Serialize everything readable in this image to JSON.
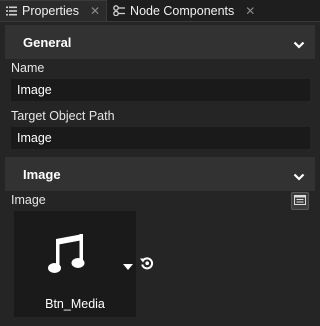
{
  "tabs": [
    {
      "label": "Properties",
      "active": true
    },
    {
      "label": "Node Components",
      "active": false
    }
  ],
  "sections": {
    "general": {
      "title": "General"
    },
    "image": {
      "title": "Image"
    }
  },
  "fields": {
    "name_label": "Name",
    "name_value": "Image",
    "target_label": "Target Object Path",
    "target_value": "Image",
    "image_label": "Image",
    "image_asset": "Btn_Media"
  },
  "colors": {
    "background": "#252526",
    "section_header": "#323232",
    "input_background": "#1a1a1a"
  }
}
